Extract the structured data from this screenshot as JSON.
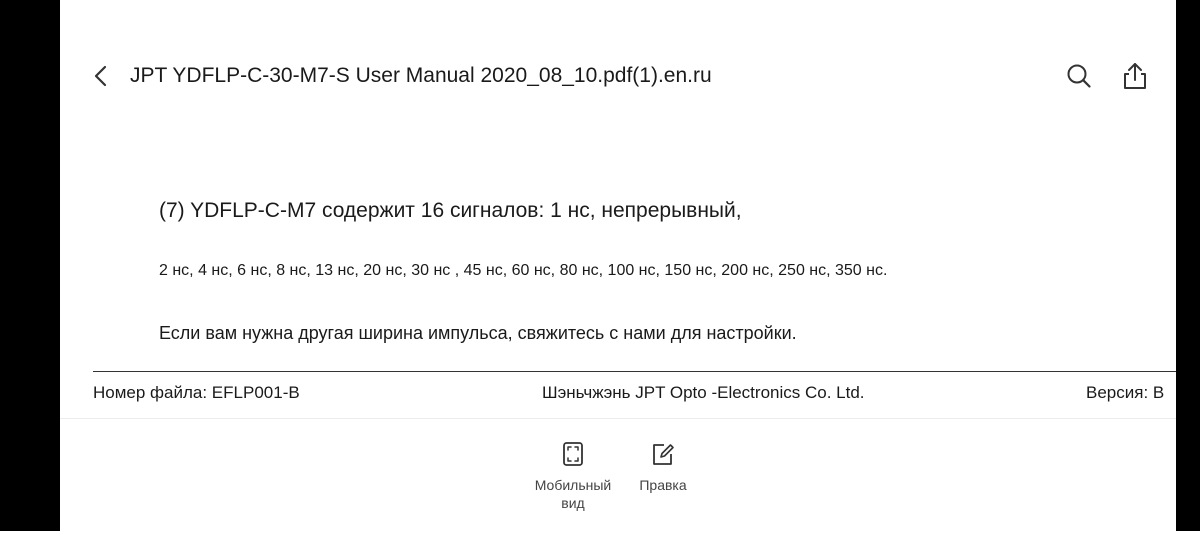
{
  "header": {
    "title": "JPT YDFLP-C-30-M7-S User Manual 2020_08_10.pdf(1).en.ru",
    "icons": [
      "chevron-left-icon",
      "search-icon",
      "share-icon"
    ]
  },
  "document": {
    "line1": "(7) YDFLP-C-M7 содержит 16 сигналов: 1 нс, непрерывный,",
    "line2": "2 нс, 4 нс, 6 нс, 8 нс, 13 нс, 20 нс, 30 нс   ,   45 нс, 60 нс, 80 нс, 100 нс, 150 нс, 200 нс, 250 нс, 350 нс.",
    "line3": "Если вам нужна другая ширина импульса, свяжитесь с нами для настройки.",
    "footer": {
      "left": "Номер файла: EFLP001-B",
      "center": "Шэньчжэнь JPT Opto -Electronics Co. Ltd.",
      "right": "Версия: B"
    }
  },
  "toolbar": {
    "mobile_view_line1": "Мобильный",
    "mobile_view_line2": "вид",
    "edit_label": "Правка",
    "icons": [
      "mobile-view-icon",
      "edit-icon"
    ]
  },
  "colors": {
    "background": "#ffffff",
    "frame": "#000000",
    "text": "#1a1a1a",
    "status_accent": "#ff8a1f"
  }
}
